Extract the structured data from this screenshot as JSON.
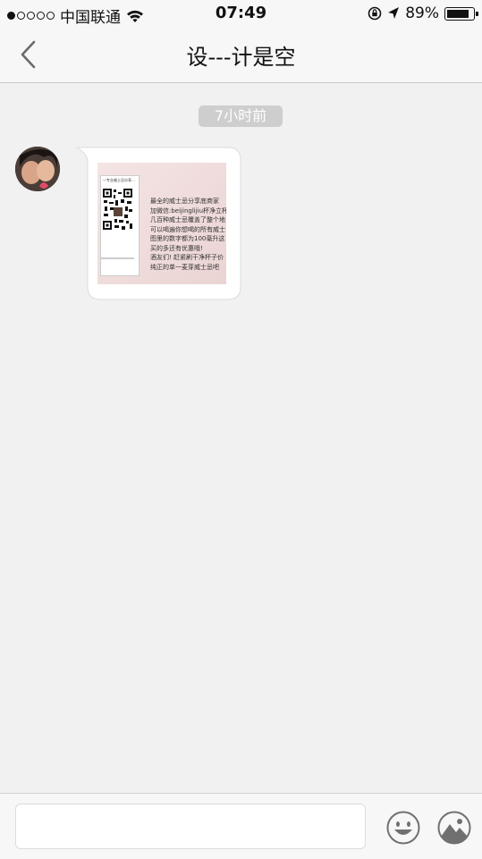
{
  "status_bar": {
    "carrier": "中国联通",
    "time": "07:49",
    "battery_percent": "89%",
    "battery_level": 0.89,
    "signal_bars_filled": 1,
    "signal_bars_total": 5
  },
  "nav": {
    "title": "设---计是空",
    "back_icon": "chevron-left-icon"
  },
  "chat": {
    "timestamp": "7小时前",
    "message": {
      "type": "image",
      "image_text": {
        "poster_title": "一专业威士忌分享...",
        "lines": [
          "最全的威士忌分享底商家",
          "加微信:beijinglijiu杯净立杯",
          "几百种威士忌覆盖了整个地",
          "可以喝遍你想喝的所有威士",
          "图里的数字都为100毫升这",
          "买的多还有优惠哦!",
          "酒友们! 赶紧刷干净杯子价",
          "纯正的单一麦芽威士忌吧"
        ]
      }
    }
  },
  "input_bar": {
    "placeholder": "",
    "value": "",
    "emoji_icon": "smiley-icon",
    "image_icon": "image-icon"
  },
  "colors": {
    "background": "#f1f1f1",
    "bar": "#f7f7f7",
    "timestamp_chip": "#cecece",
    "icon_gray": "#707070"
  }
}
